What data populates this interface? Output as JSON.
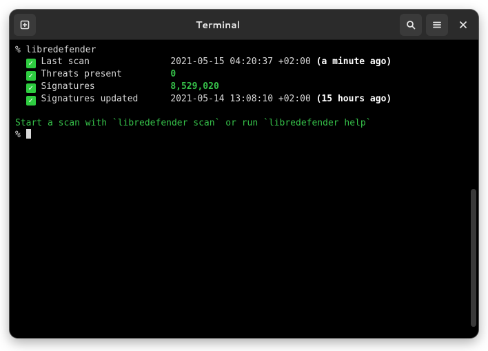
{
  "titlebar": {
    "title": "Terminal"
  },
  "terminal": {
    "prompt": "%",
    "command": "libredefender",
    "rows": [
      {
        "label": "Last scan",
        "value": "2021-05-15 04:20:37 +02:00",
        "note": "(a minute ago)",
        "value_green": false
      },
      {
        "label": "Threats present",
        "value": "0",
        "note": "",
        "value_green": true
      },
      {
        "label": "Signatures",
        "value": "8,529,020",
        "note": "",
        "value_green": true
      },
      {
        "label": "Signatures updated",
        "value": "2021-05-14 13:08:10 +02:00",
        "note": "(15 hours ago)",
        "value_green": false
      }
    ],
    "hint": "Start a scan with `libredefender scan` or run `libredefender help`"
  }
}
